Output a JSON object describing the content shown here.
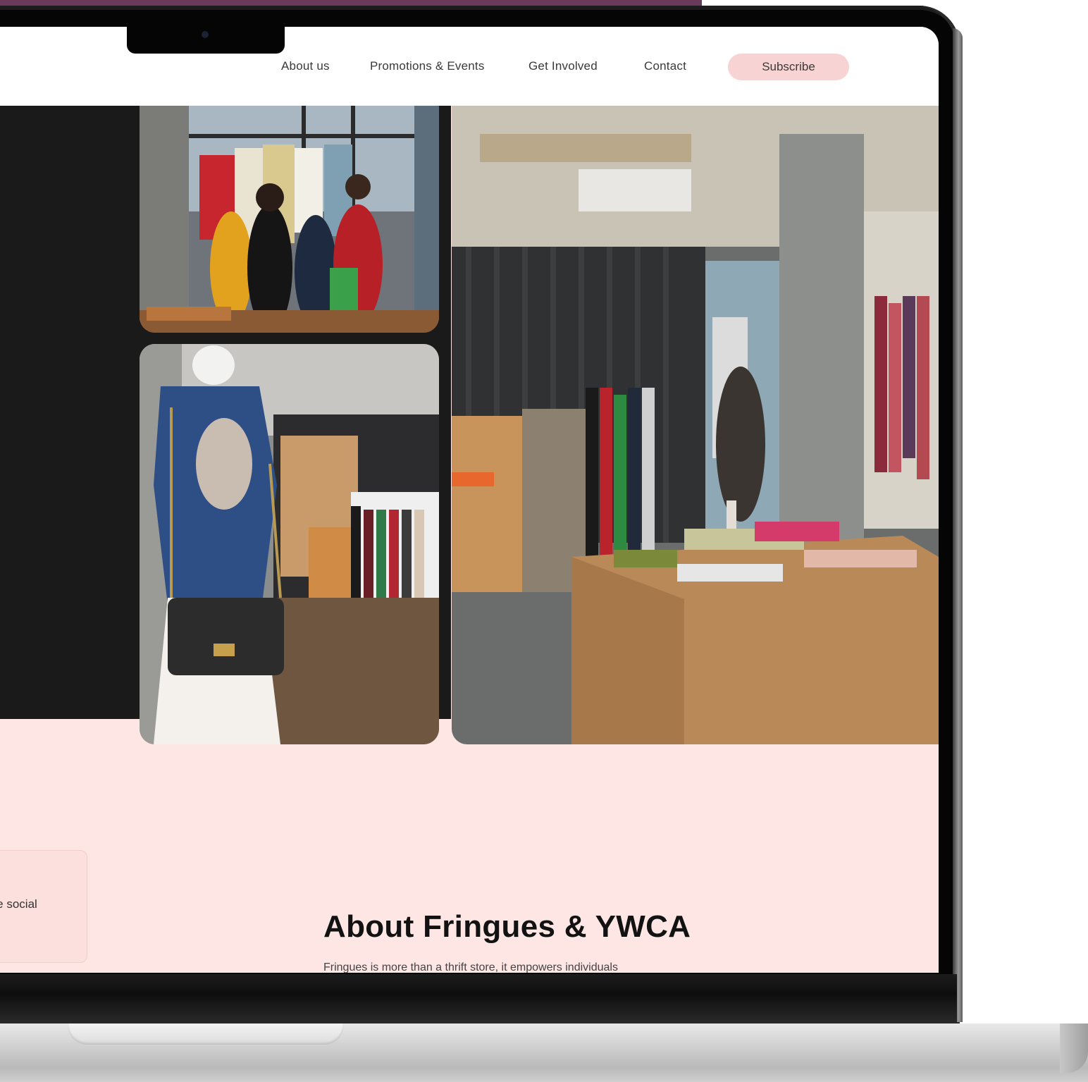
{
  "nav": {
    "about": "About us",
    "promotions": "Promotions & Events",
    "involved": "Get Involved",
    "contact": "Contact",
    "subscribe": "Subscribe"
  },
  "card": {
    "text": "ate social"
  },
  "about": {
    "title": "About Fringues & YWCA",
    "body": "Fringues is more than a thrift store, it empowers individuals"
  },
  "colors": {
    "accent_pink": "#f7d3d3",
    "section_bg": "#fde6e3",
    "frame_purple": "#6a3a5c"
  }
}
